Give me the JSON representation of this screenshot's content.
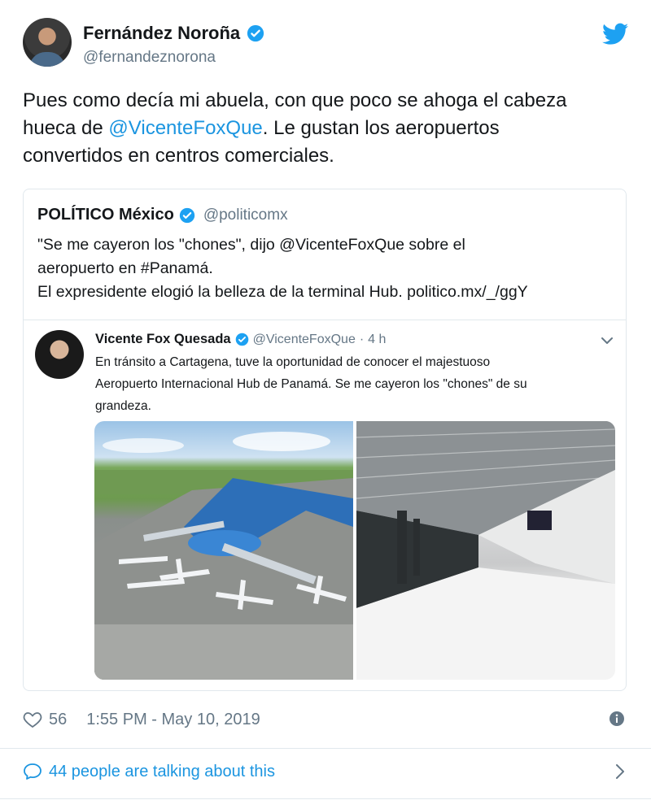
{
  "author": {
    "name": "Fernández Noroña",
    "handle": "@fernandeznorona"
  },
  "tweet": {
    "line1": "Pues como decía mi abuela, con que poco se ahoga el cabeza",
    "line2_pre": "hueca de ",
    "line2_mention": "@VicenteFoxQue",
    "line2_post": ". Le gustan los aeropuertos",
    "line3": "convertidos en centros comerciales."
  },
  "quote": {
    "name": "POLÍTICO México",
    "handle": "@politicomx",
    "line1": "\"Se me cayeron los \"chones\", dijo @VicenteFoxQue sobre el",
    "line2": "aeropuerto en #Panamá.",
    "line3": "El expresidente elogió la belleza de la terminal Hub. politico.mx/_/ggY"
  },
  "inner_tweet": {
    "name": "Vicente Fox Quesada",
    "handle": "@VicenteFoxQue",
    "separator": "·",
    "time": "4 h",
    "line1": "En tránsito a Cartagena, tuve la oportunidad de conocer el majestuoso",
    "line2": "Aeropuerto Internacional Hub de Panamá. Se me cayeron los \"chones\" de su",
    "line3": "grandeza."
  },
  "footer": {
    "likes": "56",
    "timestamp": "1:55 PM - May 10, 2019",
    "talking": "44 people are talking about this"
  },
  "colors": {
    "link": "#1b95e0",
    "muted": "#657786",
    "text": "#14171a",
    "border": "#e1e8ed"
  },
  "icons": [
    "verified-icon",
    "twitter-bird-icon",
    "chevron-down-icon",
    "heart-icon",
    "info-icon",
    "comment-bubble-icon",
    "chevron-right-icon"
  ]
}
